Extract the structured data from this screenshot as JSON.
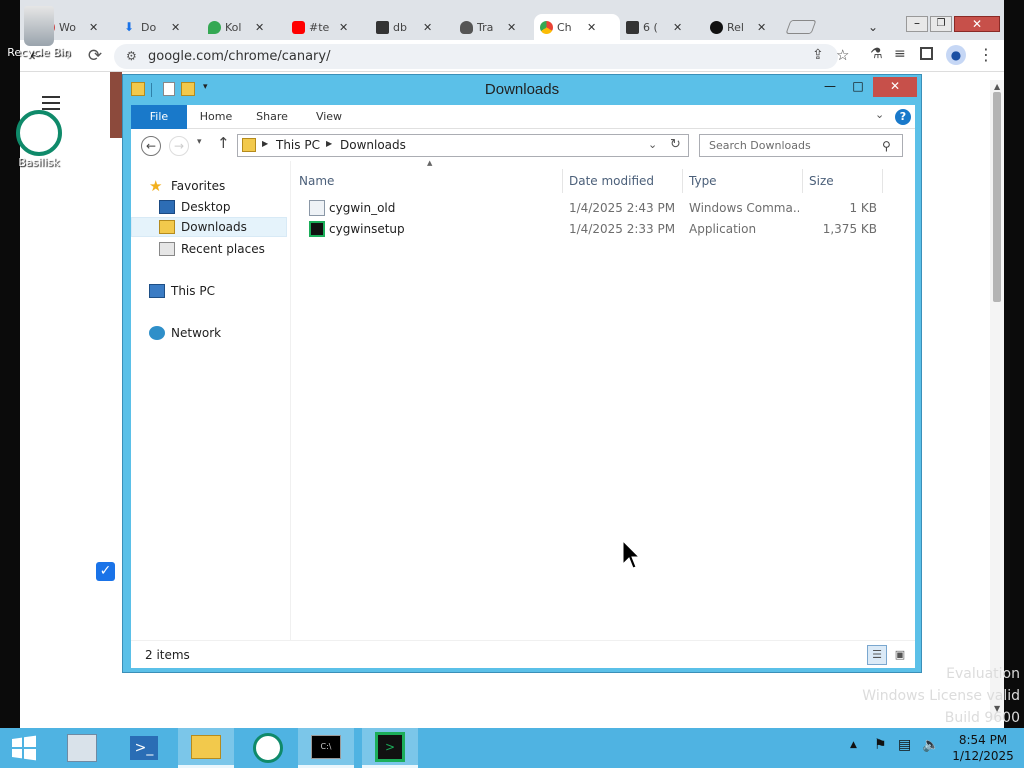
{
  "desktop": {
    "icons": [
      {
        "label": "Recycle Bin",
        "icon": "recycle-bin-icon"
      },
      {
        "label": "Basilisk",
        "icon": "basilisk-icon"
      }
    ],
    "watermark": [
      "Evaluation",
      "Windows License valid",
      "Build 9600"
    ]
  },
  "browser": {
    "tabs": [
      {
        "title": "Wo",
        "icon": "web-icon",
        "color": "#c44"
      },
      {
        "title": "Do",
        "icon": "download-icon",
        "color": "#1a73e8"
      },
      {
        "title": "Kol",
        "icon": "maps-icon",
        "color": "#34a853"
      },
      {
        "title": "#te",
        "icon": "youtube-icon",
        "color": "#ff0000"
      },
      {
        "title": "db",
        "icon": "terminal-icon",
        "color": "#333"
      },
      {
        "title": "Tra",
        "icon": "bulb-icon",
        "color": "#555"
      },
      {
        "title": "Ch",
        "icon": "chrome-icon",
        "color": "#fbbc05",
        "active": true
      },
      {
        "title": "6 (",
        "icon": "terminal-icon",
        "color": "#333"
      },
      {
        "title": "Rel",
        "icon": "github-icon",
        "color": "#111"
      }
    ],
    "url": "google.com/chrome/canary/"
  },
  "explorer": {
    "title": "Downloads",
    "ribbon_tabs": [
      "File",
      "Home",
      "Share",
      "View"
    ],
    "breadcrumb": [
      "This PC",
      "Downloads"
    ],
    "search_placeholder": "Search Downloads",
    "nav": {
      "favorites": "Favorites",
      "favorites_items": [
        "Desktop",
        "Downloads",
        "Recent places"
      ],
      "this_pc": "This PC",
      "network": "Network"
    },
    "columns": [
      "Name",
      "Date modified",
      "Type",
      "Size"
    ],
    "files": [
      {
        "name": "cygwin_old",
        "date": "1/4/2025 2:43 PM",
        "type": "Windows Comma...",
        "size": "1 KB",
        "icon": "batch-file-icon"
      },
      {
        "name": "cygwinsetup",
        "date": "1/4/2025 2:33 PM",
        "type": "Application",
        "size": "1,375 KB",
        "icon": "cygwin-app-icon"
      }
    ],
    "status": "2 items"
  },
  "taskbar": {
    "time": "8:54 PM",
    "date": "1/12/2025",
    "buttons": [
      "start",
      "server-manager",
      "powershell",
      "file-explorer",
      "basilisk",
      "cmd",
      "cygwin-terminal"
    ],
    "colors": {
      "taskbar": "#4fb3e2",
      "window_frame": "#5bc0e8",
      "file_tab": "#1979ca"
    }
  }
}
